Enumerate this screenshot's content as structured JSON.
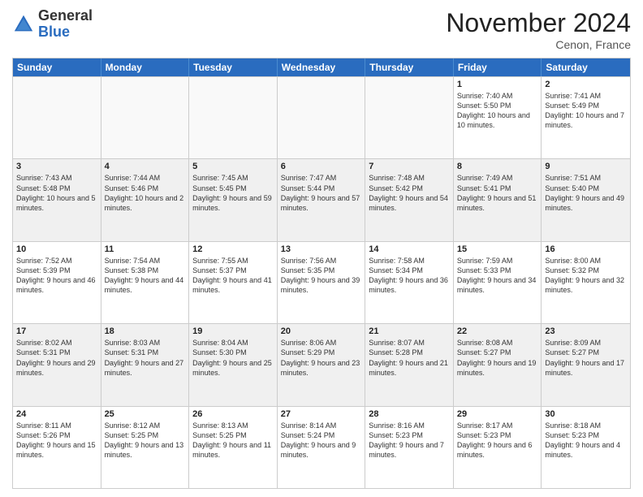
{
  "header": {
    "logo_general": "General",
    "logo_blue": "Blue",
    "month_title": "November 2024",
    "location": "Cenon, France"
  },
  "days_of_week": [
    "Sunday",
    "Monday",
    "Tuesday",
    "Wednesday",
    "Thursday",
    "Friday",
    "Saturday"
  ],
  "weeks": [
    [
      {
        "day": "",
        "info": ""
      },
      {
        "day": "",
        "info": ""
      },
      {
        "day": "",
        "info": ""
      },
      {
        "day": "",
        "info": ""
      },
      {
        "day": "",
        "info": ""
      },
      {
        "day": "1",
        "info": "Sunrise: 7:40 AM\nSunset: 5:50 PM\nDaylight: 10 hours and 10 minutes."
      },
      {
        "day": "2",
        "info": "Sunrise: 7:41 AM\nSunset: 5:49 PM\nDaylight: 10 hours and 7 minutes."
      }
    ],
    [
      {
        "day": "3",
        "info": "Sunrise: 7:43 AM\nSunset: 5:48 PM\nDaylight: 10 hours and 5 minutes."
      },
      {
        "day": "4",
        "info": "Sunrise: 7:44 AM\nSunset: 5:46 PM\nDaylight: 10 hours and 2 minutes."
      },
      {
        "day": "5",
        "info": "Sunrise: 7:45 AM\nSunset: 5:45 PM\nDaylight: 9 hours and 59 minutes."
      },
      {
        "day": "6",
        "info": "Sunrise: 7:47 AM\nSunset: 5:44 PM\nDaylight: 9 hours and 57 minutes."
      },
      {
        "day": "7",
        "info": "Sunrise: 7:48 AM\nSunset: 5:42 PM\nDaylight: 9 hours and 54 minutes."
      },
      {
        "day": "8",
        "info": "Sunrise: 7:49 AM\nSunset: 5:41 PM\nDaylight: 9 hours and 51 minutes."
      },
      {
        "day": "9",
        "info": "Sunrise: 7:51 AM\nSunset: 5:40 PM\nDaylight: 9 hours and 49 minutes."
      }
    ],
    [
      {
        "day": "10",
        "info": "Sunrise: 7:52 AM\nSunset: 5:39 PM\nDaylight: 9 hours and 46 minutes."
      },
      {
        "day": "11",
        "info": "Sunrise: 7:54 AM\nSunset: 5:38 PM\nDaylight: 9 hours and 44 minutes."
      },
      {
        "day": "12",
        "info": "Sunrise: 7:55 AM\nSunset: 5:37 PM\nDaylight: 9 hours and 41 minutes."
      },
      {
        "day": "13",
        "info": "Sunrise: 7:56 AM\nSunset: 5:35 PM\nDaylight: 9 hours and 39 minutes."
      },
      {
        "day": "14",
        "info": "Sunrise: 7:58 AM\nSunset: 5:34 PM\nDaylight: 9 hours and 36 minutes."
      },
      {
        "day": "15",
        "info": "Sunrise: 7:59 AM\nSunset: 5:33 PM\nDaylight: 9 hours and 34 minutes."
      },
      {
        "day": "16",
        "info": "Sunrise: 8:00 AM\nSunset: 5:32 PM\nDaylight: 9 hours and 32 minutes."
      }
    ],
    [
      {
        "day": "17",
        "info": "Sunrise: 8:02 AM\nSunset: 5:31 PM\nDaylight: 9 hours and 29 minutes."
      },
      {
        "day": "18",
        "info": "Sunrise: 8:03 AM\nSunset: 5:31 PM\nDaylight: 9 hours and 27 minutes."
      },
      {
        "day": "19",
        "info": "Sunrise: 8:04 AM\nSunset: 5:30 PM\nDaylight: 9 hours and 25 minutes."
      },
      {
        "day": "20",
        "info": "Sunrise: 8:06 AM\nSunset: 5:29 PM\nDaylight: 9 hours and 23 minutes."
      },
      {
        "day": "21",
        "info": "Sunrise: 8:07 AM\nSunset: 5:28 PM\nDaylight: 9 hours and 21 minutes."
      },
      {
        "day": "22",
        "info": "Sunrise: 8:08 AM\nSunset: 5:27 PM\nDaylight: 9 hours and 19 minutes."
      },
      {
        "day": "23",
        "info": "Sunrise: 8:09 AM\nSunset: 5:27 PM\nDaylight: 9 hours and 17 minutes."
      }
    ],
    [
      {
        "day": "24",
        "info": "Sunrise: 8:11 AM\nSunset: 5:26 PM\nDaylight: 9 hours and 15 minutes."
      },
      {
        "day": "25",
        "info": "Sunrise: 8:12 AM\nSunset: 5:25 PM\nDaylight: 9 hours and 13 minutes."
      },
      {
        "day": "26",
        "info": "Sunrise: 8:13 AM\nSunset: 5:25 PM\nDaylight: 9 hours and 11 minutes."
      },
      {
        "day": "27",
        "info": "Sunrise: 8:14 AM\nSunset: 5:24 PM\nDaylight: 9 hours and 9 minutes."
      },
      {
        "day": "28",
        "info": "Sunrise: 8:16 AM\nSunset: 5:23 PM\nDaylight: 9 hours and 7 minutes."
      },
      {
        "day": "29",
        "info": "Sunrise: 8:17 AM\nSunset: 5:23 PM\nDaylight: 9 hours and 6 minutes."
      },
      {
        "day": "30",
        "info": "Sunrise: 8:18 AM\nSunset: 5:23 PM\nDaylight: 9 hours and 4 minutes."
      }
    ]
  ]
}
